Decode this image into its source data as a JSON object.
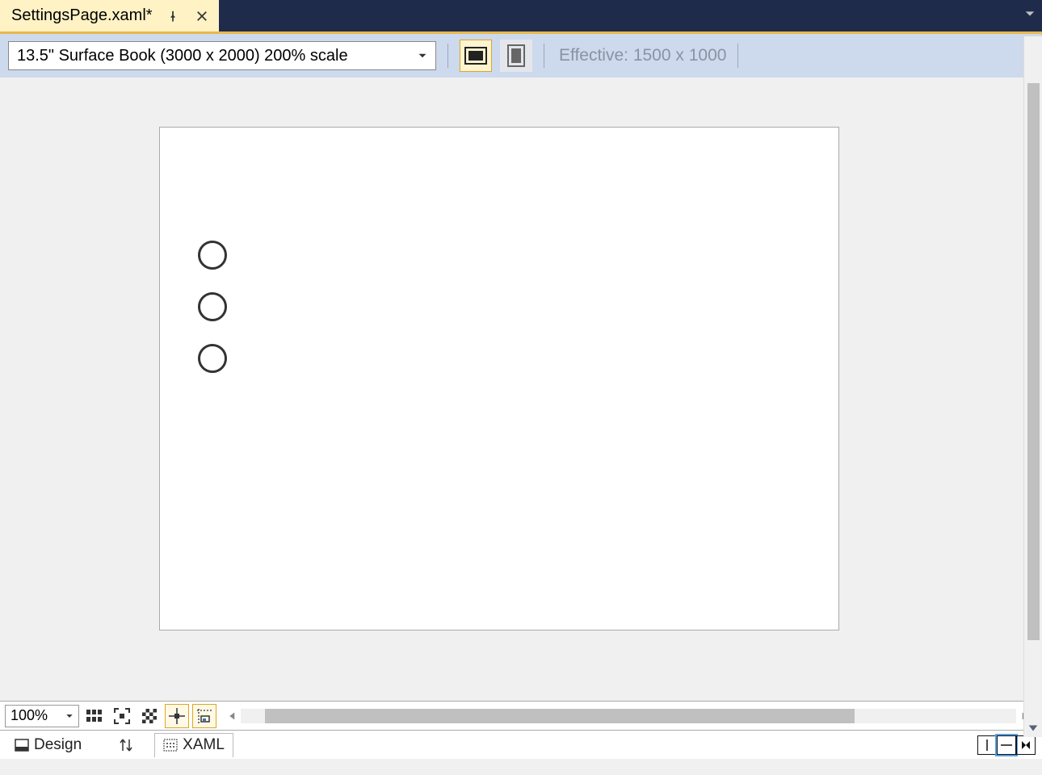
{
  "tab": {
    "title": "SettingsPage.xaml*"
  },
  "designer_toolbar": {
    "device": "13.5\" Surface Book (3000 x 2000) 200% scale",
    "effective": "Effective: 1500 x 1000"
  },
  "bottom_toolbar": {
    "zoom": "100%"
  },
  "xaml_bar": {
    "design_tab": "Design",
    "xaml_tab": "XAML"
  }
}
